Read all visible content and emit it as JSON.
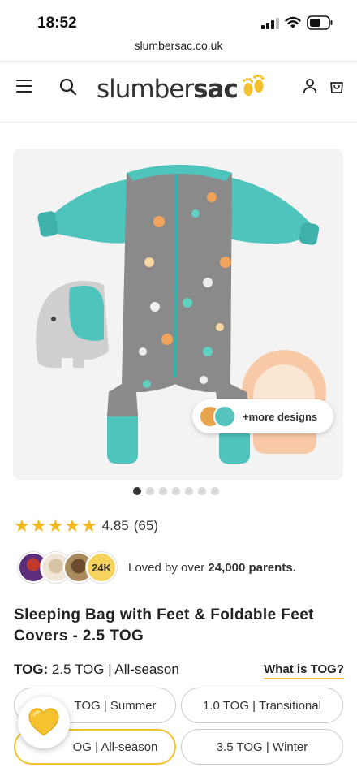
{
  "status_bar": {
    "time": "18:52"
  },
  "browser": {
    "url": "slumbersac.co.uk"
  },
  "header": {
    "logo_text_a": "slumber",
    "logo_text_b": "sac"
  },
  "gallery": {
    "more_designs_label": "+more designs",
    "slide_count": 7,
    "active_slide": 1
  },
  "rating": {
    "stars": 5,
    "value": "4.85",
    "count": "(65)",
    "star_color": "#f3b71b"
  },
  "social_proof": {
    "badge": "24K",
    "text_prefix": "Loved by over ",
    "text_bold": "24,000 parents."
  },
  "product": {
    "title": "Sleeping Bag with Feet & Foldable Feet Covers - 2.5 TOG"
  },
  "tog": {
    "label": "TOG:",
    "value": "2.5 TOG | All-season",
    "help_link": "What is TOG?",
    "options": [
      {
        "label": "0.5 TOG | Summer",
        "display": "TOG | Summer"
      },
      {
        "label": "1.0 TOG | Transitional",
        "display": "1.0 TOG | Transitional"
      },
      {
        "label": "2.5 TOG | All-season",
        "display": "OG | All-season",
        "selected": true
      },
      {
        "label": "3.5 TOG | Winter",
        "display": "3.5 TOG | Winter"
      }
    ]
  },
  "colors": {
    "accent": "#f2c230",
    "teal": "#4fc4bd",
    "grey": "#8a8a8a"
  }
}
